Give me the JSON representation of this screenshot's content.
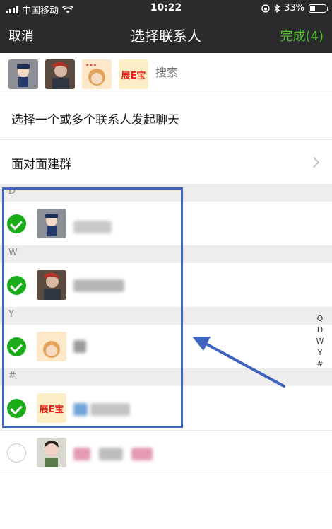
{
  "status": {
    "carrier": "中国移动",
    "time": "10:22",
    "battery": "33%",
    "battery_level": 0.33
  },
  "nav": {
    "cancel": "取消",
    "title": "选择联系人",
    "done": "完成(4)"
  },
  "selected": {
    "search_placeholder": "搜索",
    "thumb_text": "展E宝"
  },
  "rows": {
    "start_chat": "选择一个或多个联系人发起聊天",
    "face_group": "面对面建群"
  },
  "sections": [
    "D",
    "W",
    "Y",
    "#"
  ],
  "contacts": [
    {
      "section": "D",
      "checked": true
    },
    {
      "section": "W",
      "checked": true
    },
    {
      "section": "Y",
      "checked": true
    },
    {
      "section": "#",
      "checked": true,
      "avatar_text": "展E宝"
    },
    {
      "section": "",
      "checked": false
    }
  ],
  "index": [
    "Q",
    "D",
    "W",
    "Y",
    "#"
  ],
  "colors": {
    "accent": "#1aad19",
    "done": "#4fc32e",
    "highlight": "#3e63c0",
    "arrow": "#3e63c0"
  }
}
